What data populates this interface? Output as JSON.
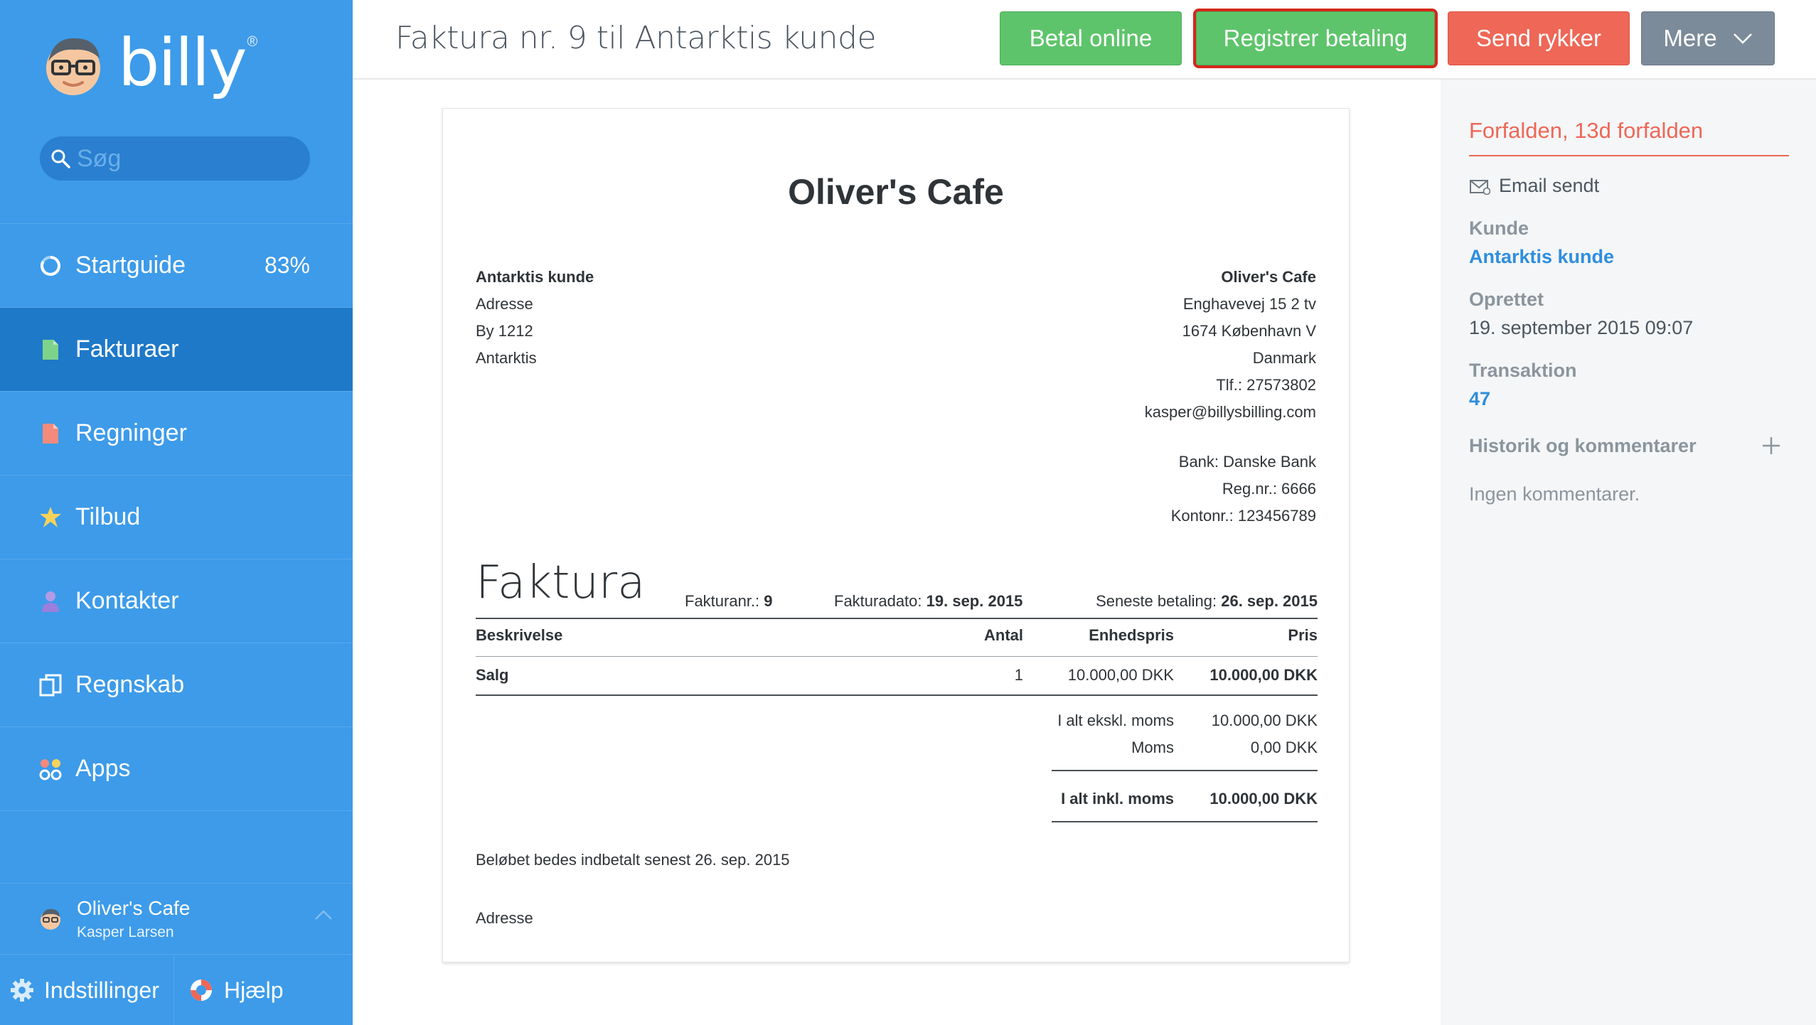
{
  "brand": {
    "name": "billy",
    "registered": "®",
    "accent": "#3d9be9",
    "accent_dark": "#1e79c8"
  },
  "search": {
    "placeholder": "Søg"
  },
  "nav": [
    {
      "label": "Startguide",
      "icon": "progress-ring-icon",
      "percent": "83%"
    },
    {
      "label": "Fakturaer",
      "icon": "invoice-document-icon",
      "active": true
    },
    {
      "label": "Regninger",
      "icon": "bill-document-icon"
    },
    {
      "label": "Tilbud",
      "icon": "star-badge-icon"
    },
    {
      "label": "Kontakter",
      "icon": "person-icon"
    },
    {
      "label": "Regnskab",
      "icon": "ledger-icon"
    },
    {
      "label": "Apps",
      "icon": "apps-icon"
    }
  ],
  "org": {
    "name": "Oliver's Cafe",
    "user": "Kasper Larsen"
  },
  "bottom": {
    "settings": "Indstillinger",
    "help": "Hjælp"
  },
  "header": {
    "title": "Faktura nr. 9 til Antarktis kunde",
    "buttons": {
      "pay_online": "Betal online",
      "register_payment": "Registrer betaling",
      "send_reminder": "Send rykker",
      "more": "Mere"
    }
  },
  "invoice": {
    "company": "Oliver's Cafe",
    "customer": {
      "name": "Antarktis kunde",
      "address": "Adresse",
      "city": "By 1212",
      "country": "Antarktis"
    },
    "sender": {
      "name": "Oliver's Cafe",
      "street": "Enghavevej 15 2 tv",
      "city": "1674 København V",
      "country": "Danmark",
      "phone": "Tlf.: 27573802",
      "email": "kasper@billysbilling.com"
    },
    "bank": {
      "bank": "Bank: Danske Bank",
      "reg": "Reg.nr.: 6666",
      "account": "Kontonr.: 123456789"
    },
    "heading": "Faktura",
    "number_label": "Fakturanr.:",
    "number": "9",
    "date_label": "Fakturadato:",
    "date": "19. sep. 2015",
    "due_label": "Seneste betaling:",
    "due": "26. sep. 2015",
    "columns": {
      "description": "Beskrivelse",
      "qty": "Antal",
      "unit_price": "Enhedspris",
      "price": "Pris"
    },
    "lines": [
      {
        "description": "Salg",
        "qty": "1",
        "unit_price": "10.000,00 DKK",
        "price": "10.000,00 DKK"
      }
    ],
    "totals": {
      "excl_label": "I alt ekskl. moms",
      "excl": "10.000,00 DKK",
      "vat_label": "Moms",
      "vat": "0,00 DKK",
      "incl_label": "I alt inkl. moms",
      "incl": "10.000,00 DKK"
    },
    "note": "Beløbet bedes indbetalt senest 26. sep. 2015",
    "footer_address": "Adresse"
  },
  "panel": {
    "status": "Forfalden, 13d forfalden",
    "email_sent": "Email sendt",
    "customer_label": "Kunde",
    "customer": "Antarktis kunde",
    "created_label": "Oprettet",
    "created": "19. september 2015 09:07",
    "transaction_label": "Transaktion",
    "transaction": "47",
    "history_label": "Historik og kommentarer",
    "no_comments": "Ingen kommentarer."
  }
}
